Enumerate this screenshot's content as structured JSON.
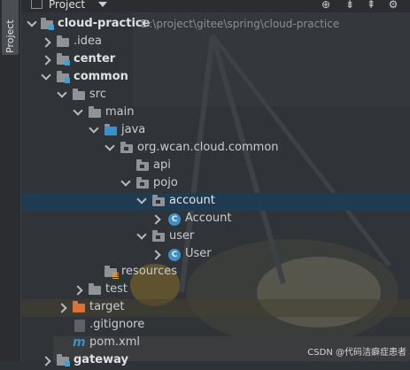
{
  "sidebar": {
    "tab_label": "Project"
  },
  "header": {
    "title": "Project",
    "icons": [
      "crosshair-icon",
      "collapse-all-icon",
      "expand-all-icon",
      "settings-icon"
    ]
  },
  "tree": {
    "root": {
      "label": "cloud-practice",
      "path": "D:\\project\\gitee\\spring\\cloud-practice"
    },
    "idea": ".idea",
    "center": "center",
    "common": "common",
    "src": "src",
    "main": "main",
    "java": "java",
    "package": "org.wcan.cloud.common",
    "api": "api",
    "pojo": "pojo",
    "account": "account",
    "account_class": "Account",
    "user": "user",
    "user_class": "User",
    "resources": "resources",
    "test": "test",
    "target": "target",
    "gitignore": ".gitignore",
    "pom": "pom.xml",
    "gateway": "gateway"
  },
  "watermark": "CSDN @代码洁癖症患者",
  "colors": {
    "selection": "#1e3c54",
    "module_mark": "#3fa0d6",
    "target_folder": "#d9733a",
    "class_icon": "#3d8fc6"
  }
}
